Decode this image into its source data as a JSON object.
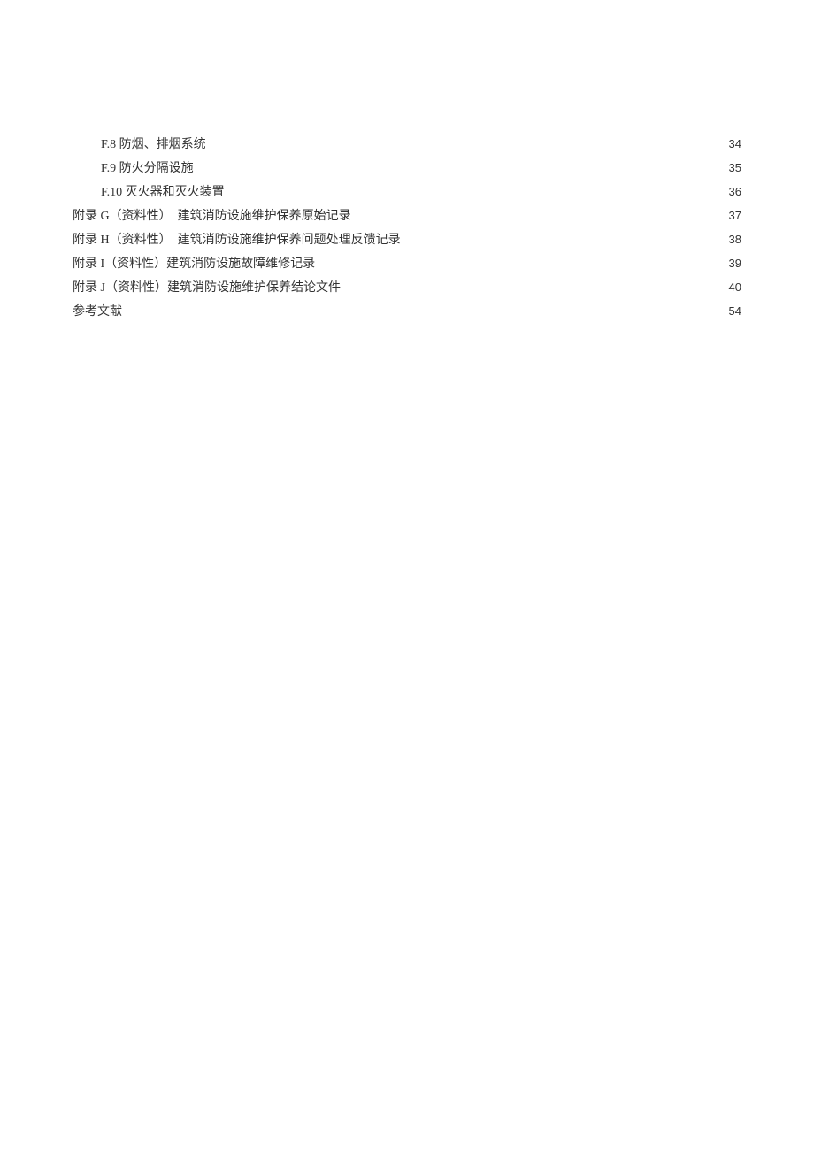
{
  "toc": {
    "entries": [
      {
        "label": "F.8 防烟、排烟系统",
        "page": "34",
        "indent": true
      },
      {
        "label": "F.9 防火分隔设施",
        "page": "35",
        "indent": true
      },
      {
        "label": "F.10 灭火器和灭火装置",
        "page": "36",
        "indent": true
      },
      {
        "label": "附录 G（资料性）　建筑消防设施维护保养原始记录",
        "page": "37",
        "indent": false
      },
      {
        "label": "附录 H（资料性）　建筑消防设施维护保养问题处理反馈记录",
        "page": "38",
        "indent": false
      },
      {
        "label": "附录 I（资料性）建筑消防设施故障维修记录",
        "page": "39",
        "indent": false
      },
      {
        "label": "附录 J（资料性）建筑消防设施维护保养结论文件",
        "page": "40",
        "indent": false
      },
      {
        "label": "参考文献",
        "page": "54",
        "indent": false
      }
    ]
  }
}
